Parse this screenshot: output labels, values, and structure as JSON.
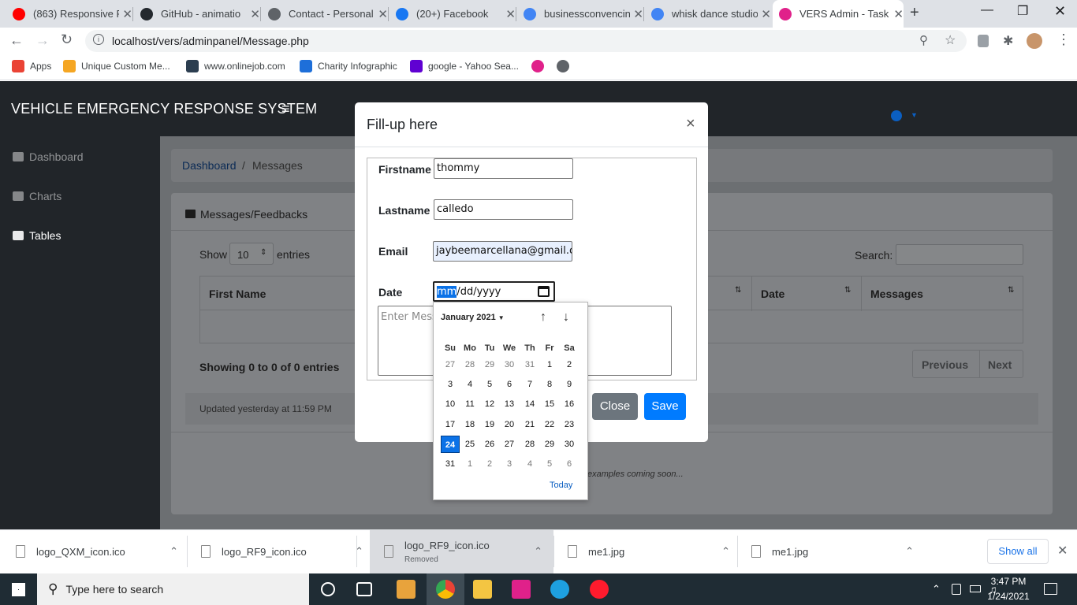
{
  "browser": {
    "tabs": [
      {
        "title": "(863) Responsive P",
        "color": "#ff0000"
      },
      {
        "title": "GitHub - animatio",
        "color": "#24292e"
      },
      {
        "title": "Contact - Personal",
        "color": "#5f6368"
      },
      {
        "title": "(20+) Facebook",
        "color": "#1877f2"
      },
      {
        "title": "businessconvencin",
        "color": "#4285f4"
      },
      {
        "title": "whisk dance studio",
        "color": "#4285f4"
      },
      {
        "title": "VERS Admin - Task",
        "color": "#e0218a"
      }
    ],
    "new_tab_label": "+",
    "url": "localhost/vers/adminpanel/Message.php",
    "bookmarks": [
      {
        "label": "Apps",
        "color": "#ea4335"
      },
      {
        "label": "Unique Custom Me...",
        "color": "#f5a623"
      },
      {
        "label": "www.onlinejob.com",
        "color": "#2c3e50"
      },
      {
        "label": "Charity Infographic",
        "color": "#1e6fd9"
      },
      {
        "label": "google - Yahoo Sea...",
        "color": "#6001d2"
      }
    ]
  },
  "app": {
    "brand": "VEHICLE EMERGENCY RESPONSE SYSTEM",
    "sidebar": [
      {
        "label": "Dashboard",
        "icon": "dashboard-icon"
      },
      {
        "label": "Charts",
        "icon": "chart-icon"
      },
      {
        "label": "Tables",
        "icon": "table-icon"
      }
    ],
    "breadcrumb": {
      "link": "Dashboard",
      "sep": "/",
      "current": "Messages"
    },
    "card_title": "Messages/Feedbacks",
    "show_label": "Show",
    "entries_value": "10",
    "entries_label": "entries",
    "search_label": "Search:",
    "columns": [
      "First Name",
      "Date",
      "Messages"
    ],
    "info": "Showing 0 to 0 of 0 entries",
    "prev": "Previous",
    "next": "Next",
    "updated": "Updated yesterday at 11:59 PM",
    "footer_note": "examples coming soon..."
  },
  "modal": {
    "title": "Fill-up here",
    "close_x": "×",
    "firstname_label": "Firstname",
    "firstname_value": "thommy",
    "lastname_label": "Lastname",
    "lastname_value": "calledo",
    "email_label": "Email",
    "email_value": "jaybeemarcellana@gmail.c",
    "date_label": "Date",
    "date_mm": "mm",
    "date_rest": "/dd/yyyy",
    "message_placeholder": "Enter Message",
    "close_btn": "Close",
    "save_btn": "Save"
  },
  "datepicker": {
    "month": "January 2021",
    "weekdays": [
      "Su",
      "Mo",
      "Tu",
      "We",
      "Th",
      "Fr",
      "Sa"
    ],
    "weeks": [
      [
        "27",
        "28",
        "29",
        "30",
        "31",
        "1",
        "2"
      ],
      [
        "3",
        "4",
        "5",
        "6",
        "7",
        "8",
        "9"
      ],
      [
        "10",
        "11",
        "12",
        "13",
        "14",
        "15",
        "16"
      ],
      [
        "17",
        "18",
        "19",
        "20",
        "21",
        "22",
        "23"
      ],
      [
        "24",
        "25",
        "26",
        "27",
        "28",
        "29",
        "30"
      ],
      [
        "31",
        "1",
        "2",
        "3",
        "4",
        "5",
        "6"
      ]
    ],
    "selected": "24",
    "today": "Today"
  },
  "downloads": [
    {
      "name": "logo_QXM_icon.ico",
      "sub": ""
    },
    {
      "name": "logo_RF9_icon.ico",
      "sub": ""
    },
    {
      "name": "logo_RF9_icon.ico",
      "sub": "Removed"
    },
    {
      "name": "me1.jpg",
      "sub": ""
    },
    {
      "name": "me1.jpg",
      "sub": ""
    }
  ],
  "show_all": "Show all",
  "taskbar": {
    "search_placeholder": "Type here to search",
    "time": "3:47 PM",
    "date": "1/24/2021"
  }
}
